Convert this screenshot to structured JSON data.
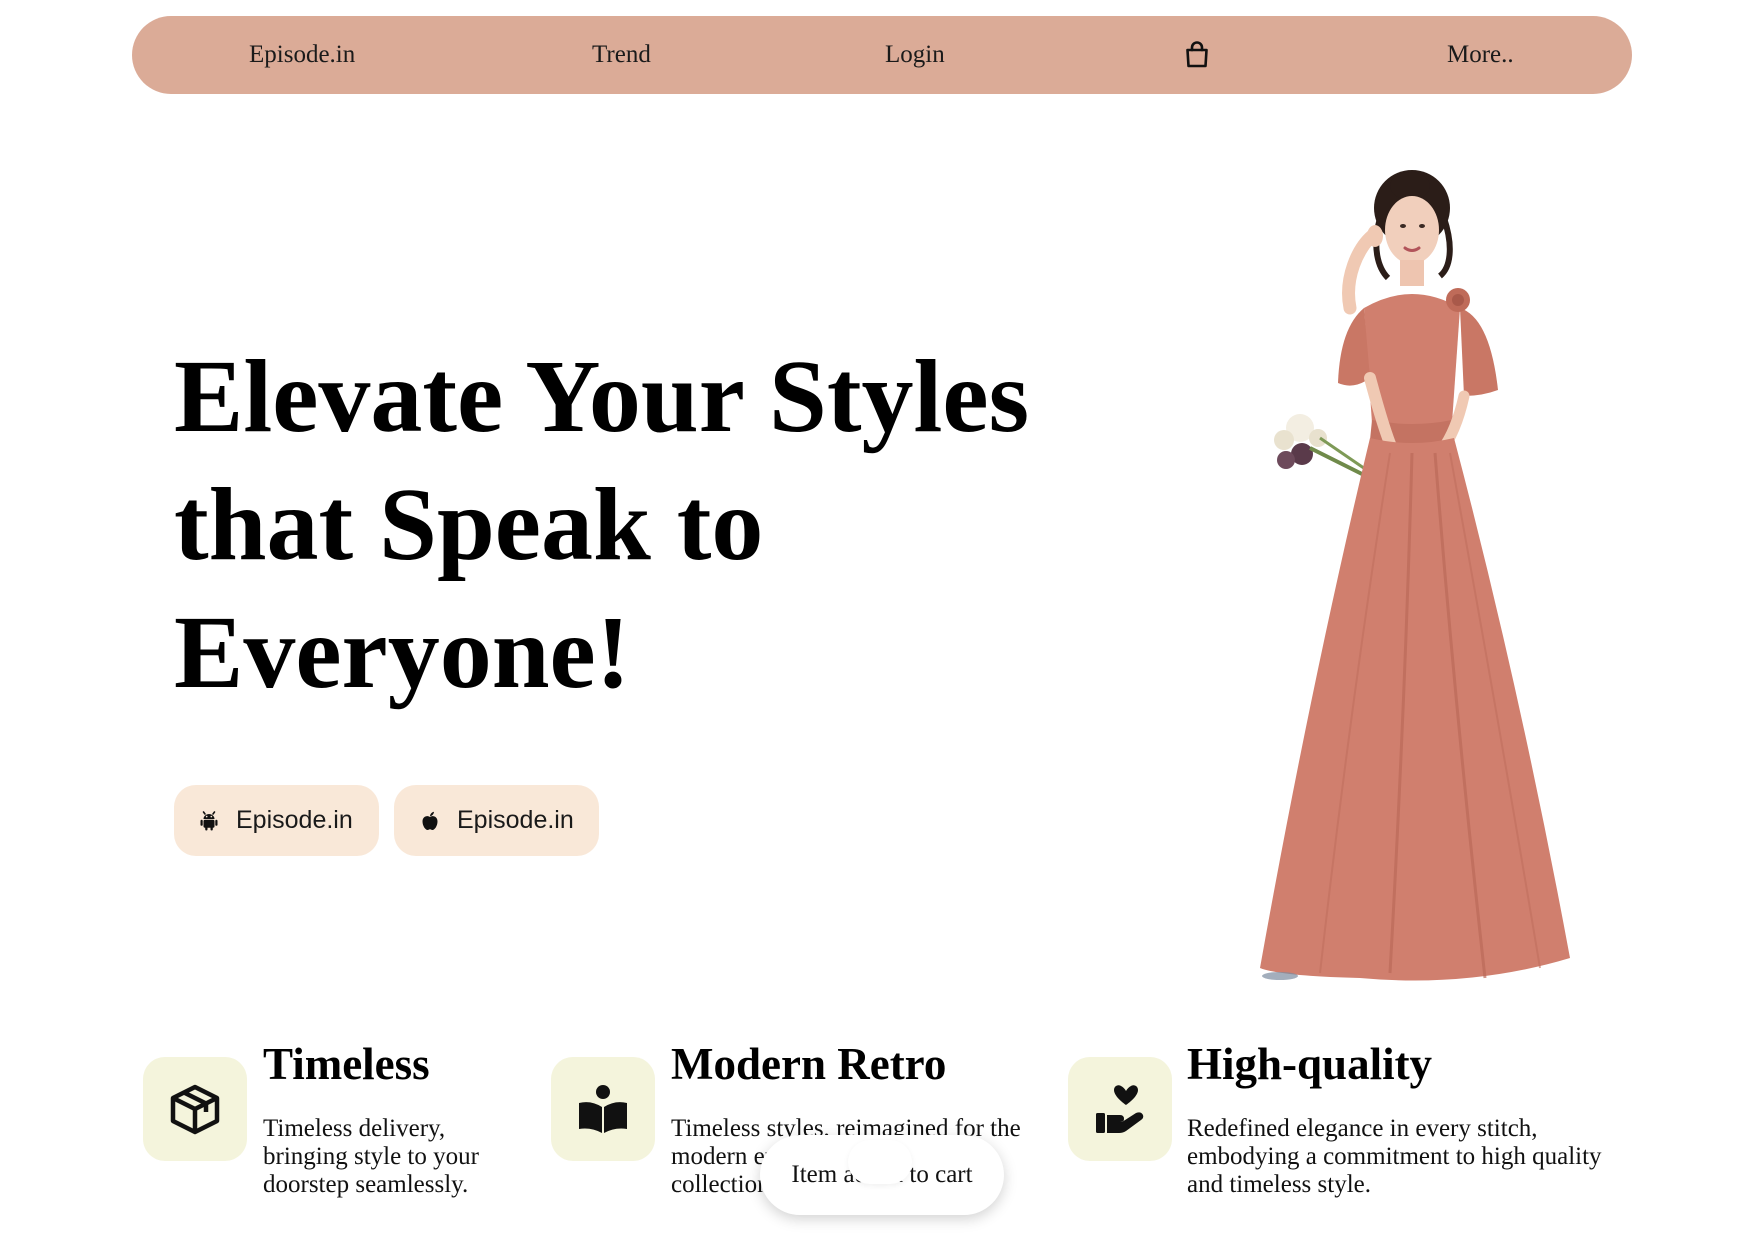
{
  "nav": {
    "brand": "Episode.in",
    "trend": "Trend",
    "login": "Login",
    "cart_icon": "shopping-bag-icon",
    "more": "More.."
  },
  "hero": {
    "line1": "Elevate Your Styles",
    "line2": "that Speak to",
    "line3": "Everyone!",
    "android_button": "Episode.in",
    "apple_button": "Episode.in",
    "android_icon": "android-icon",
    "apple_icon": "apple-icon",
    "image": "model-in-peach-gown"
  },
  "features": [
    {
      "icon": "package-box-icon",
      "title": "Timeless",
      "desc": "Timeless delivery, bringing style to your doorstep seamlessly."
    },
    {
      "icon": "reading-book-icon",
      "title": "Modern Retro",
      "desc": "Timeless styles, reimagined for the modern era in our Modern Retro collection."
    },
    {
      "icon": "hand-heart-icon",
      "title": "High-quality",
      "desc": "Redefined elegance in every stitch, embodying a commitment to high quality and timeless style."
    }
  ],
  "toast": {
    "text": "Item added to cart"
  },
  "colors": {
    "navbar": "#dbab97",
    "store_button": "#f9e8d8",
    "feature_icon_bg": "#f4f4dc",
    "dress": "#d07f6e"
  }
}
